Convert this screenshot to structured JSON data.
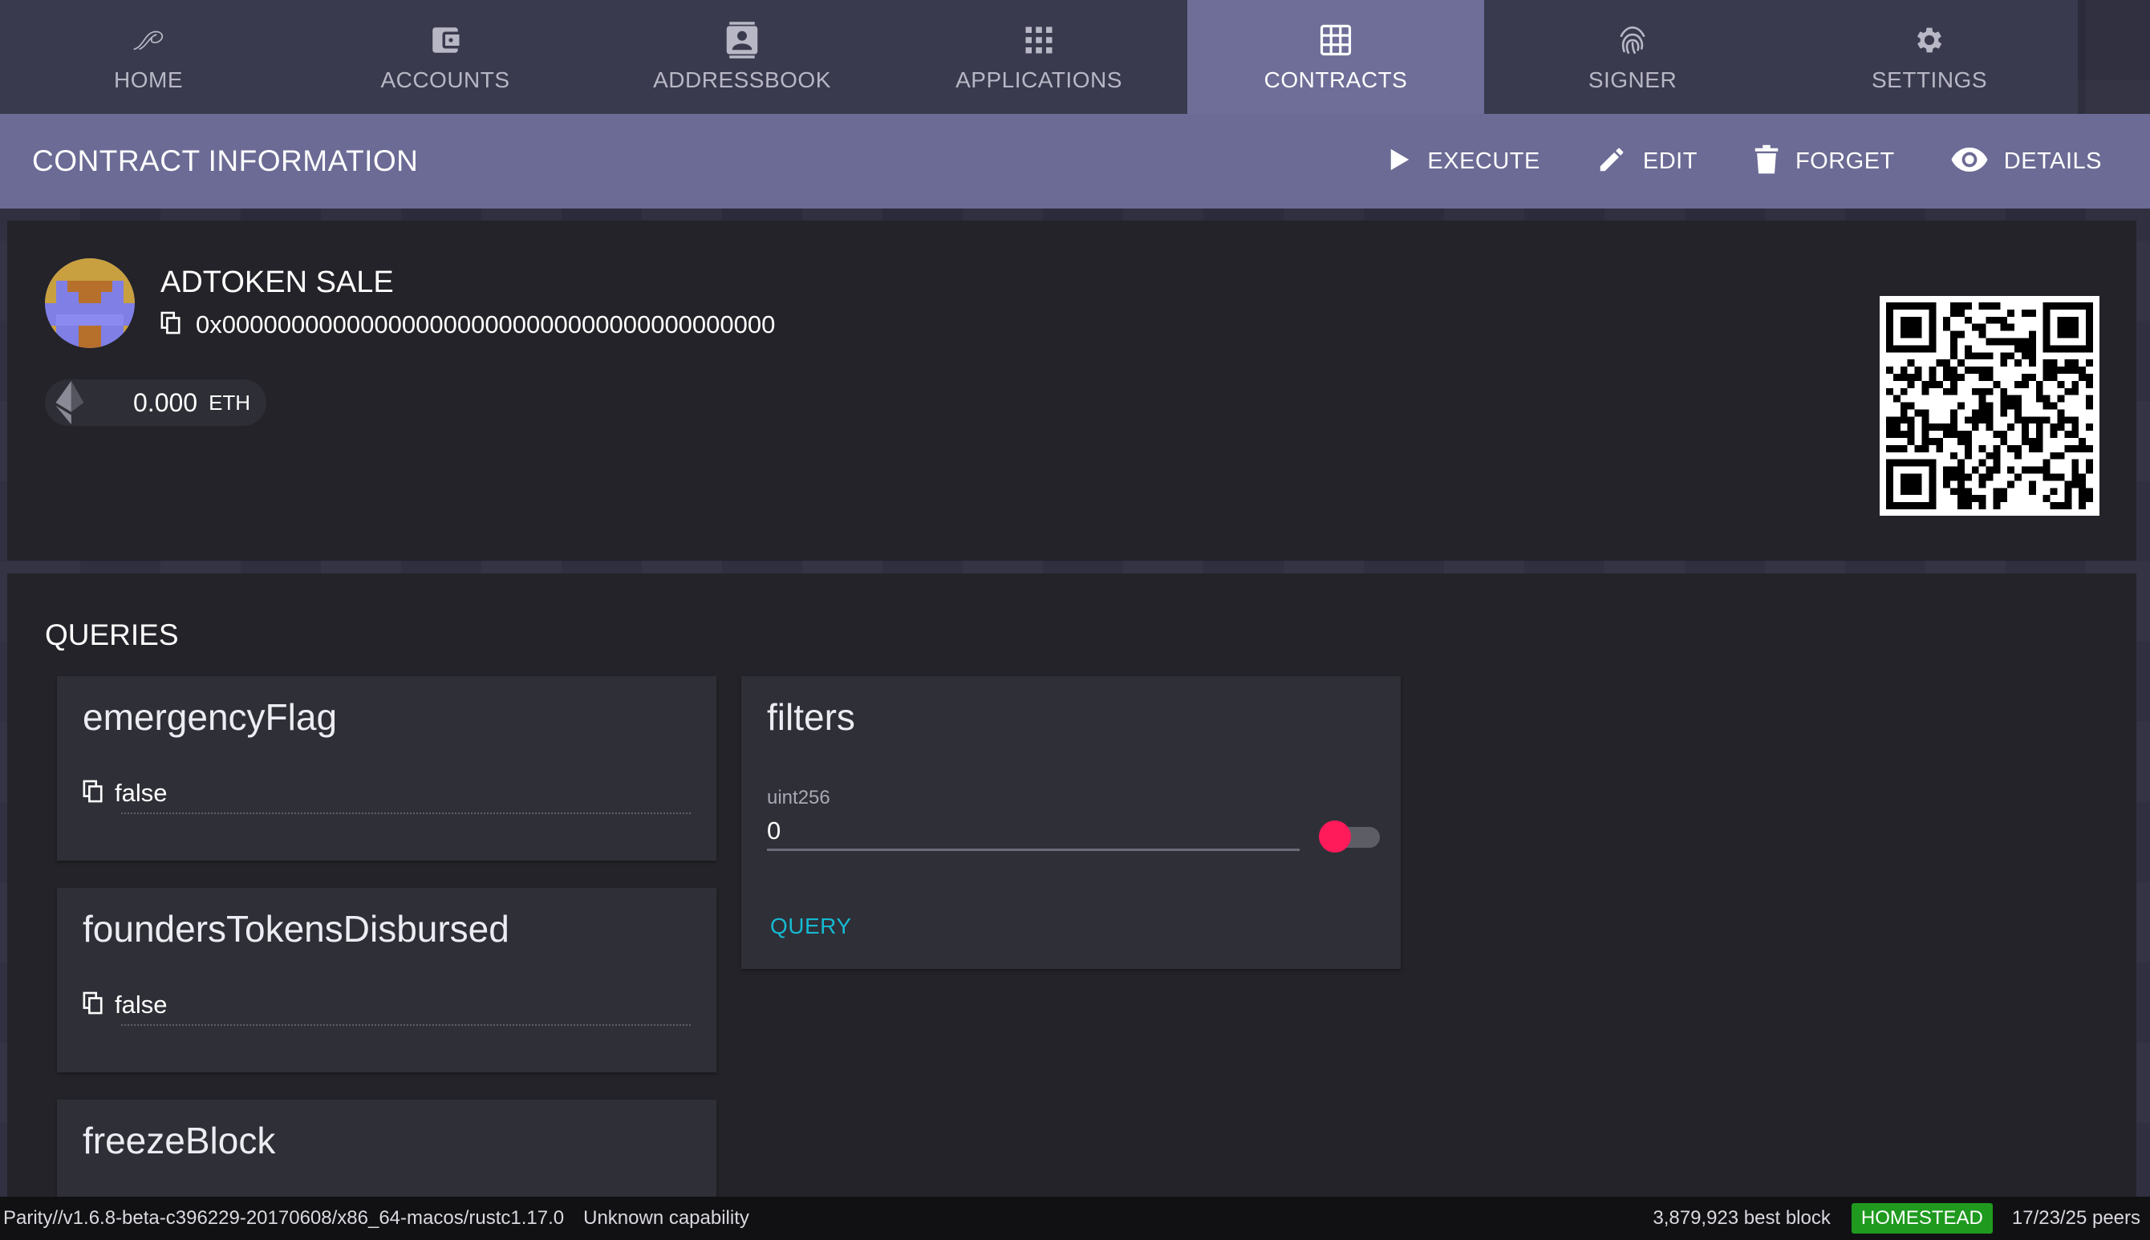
{
  "nav": {
    "tabs": [
      {
        "label": "HOME",
        "icon": "home-icon"
      },
      {
        "label": "ACCOUNTS",
        "icon": "wallet-icon"
      },
      {
        "label": "ADDRESSBOOK",
        "icon": "contact-icon"
      },
      {
        "label": "APPLICATIONS",
        "icon": "apps-grid-icon"
      },
      {
        "label": "CONTRACTS",
        "icon": "grid-table-icon",
        "active": true
      },
      {
        "label": "SIGNER",
        "icon": "fingerprint-icon"
      },
      {
        "label": "SETTINGS",
        "icon": "gear-icon"
      }
    ]
  },
  "toolbar": {
    "title": "CONTRACT INFORMATION",
    "execute_label": "EXECUTE",
    "edit_label": "EDIT",
    "forget_label": "FORGET",
    "details_label": "DETAILS"
  },
  "contract": {
    "name": "ADTOKEN SALE",
    "address": "0x0000000000000000000000000000000000000000",
    "balance_value": "0.000",
    "balance_unit": "ETH"
  },
  "queries": {
    "title": "QUERIES",
    "cards": [
      {
        "name": "emergencyFlag",
        "value": "false"
      },
      {
        "name": "foundersTokensDisbursed",
        "value": "false"
      },
      {
        "name": "freezeBlock",
        "value": ""
      }
    ],
    "filters": {
      "name": "filters",
      "param_type": "uint256",
      "param_value": "0",
      "query_label": "QUERY"
    }
  },
  "status": {
    "version": "Parity//v1.6.8-beta-c396229-20170608/x86_64-macos/rustc1.17.0",
    "capability": "Unknown capability",
    "best_block": "3,879,923 best block",
    "chain": "HOMESTEAD",
    "peers": "17/23/25 peers"
  },
  "colors": {
    "accent_active_tab": "#6e6e98",
    "toggle_thumb": "#ff1a5a",
    "query_link": "#15b9d1",
    "chain_badge": "#1f9a1f"
  }
}
